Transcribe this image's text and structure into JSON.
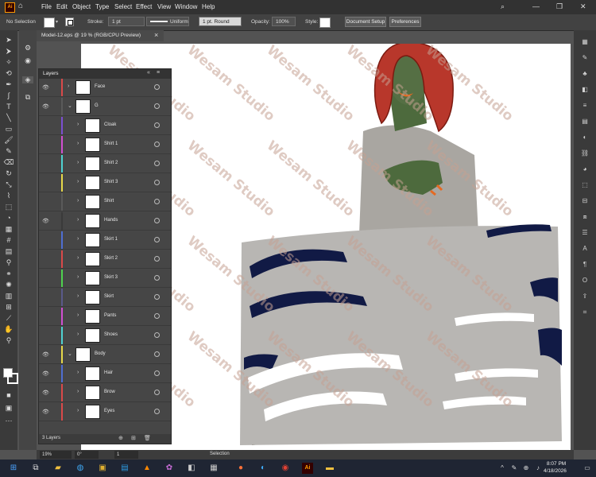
{
  "menubar": {
    "app_icon": "Ai",
    "home_icon": "home-icon",
    "items": [
      "File",
      "Edit",
      "Object",
      "Type",
      "Select",
      "Effect",
      "View",
      "Window",
      "Help"
    ]
  },
  "control_bar": {
    "selection": "No Selection",
    "stroke_label": "Stroke:",
    "stroke_weight": "1 pt",
    "profile": "Uniform",
    "brush": "1 pt. Round",
    "opacity_label": "Opacity:",
    "opacity_value": "100%",
    "style_label": "Style:",
    "doc_setup": "Document Setup",
    "preferences": "Preferences"
  },
  "document": {
    "tab_title": "Model-12.eps @ 19 % (RGB/CPU Preview)",
    "close": "×"
  },
  "layers_panel": {
    "title": "Layers",
    "footer_count": "3 Layers",
    "layers": [
      {
        "name": "Face",
        "color": "#d94a4a"
      },
      {
        "name": "G",
        "color": "#5a5a5a"
      },
      {
        "name": "Cloak",
        "color": "#7c4fd1"
      },
      {
        "name": "Shirt 1",
        "color": "#d14fd1"
      },
      {
        "name": "Shirt 2",
        "color": "#4fd1d1"
      },
      {
        "name": "Shirt 3",
        "color": "#e6d84a"
      },
      {
        "name": "Shirt",
        "color": "#5a5a5a"
      },
      {
        "name": "Hands",
        "color": "#3a3a3a"
      },
      {
        "name": "Skirt 1",
        "color": "#4f6ed1"
      },
      {
        "name": "Skirt 2",
        "color": "#d94a4a"
      },
      {
        "name": "Skirt 3",
        "color": "#4fd14f"
      },
      {
        "name": "Skirt",
        "color": "#5a5a8a"
      },
      {
        "name": "Pants",
        "color": "#d14fd1"
      },
      {
        "name": "Shoes",
        "color": "#4fd1d1"
      },
      {
        "name": "Body",
        "color": "#e6d84a"
      },
      {
        "name": "Hair",
        "color": "#4f6ed1"
      },
      {
        "name": "Brow",
        "color": "#d94a4a"
      },
      {
        "name": "Eyes",
        "color": "#d94a4a"
      }
    ]
  },
  "statusbar": {
    "zoom": "19%",
    "rotation": "0°",
    "artboard": "1",
    "mode": "Selection"
  },
  "taskbar": {
    "time": "8:07 PM",
    "date": "4/18/2026"
  },
  "watermark": "Wesam Studio"
}
